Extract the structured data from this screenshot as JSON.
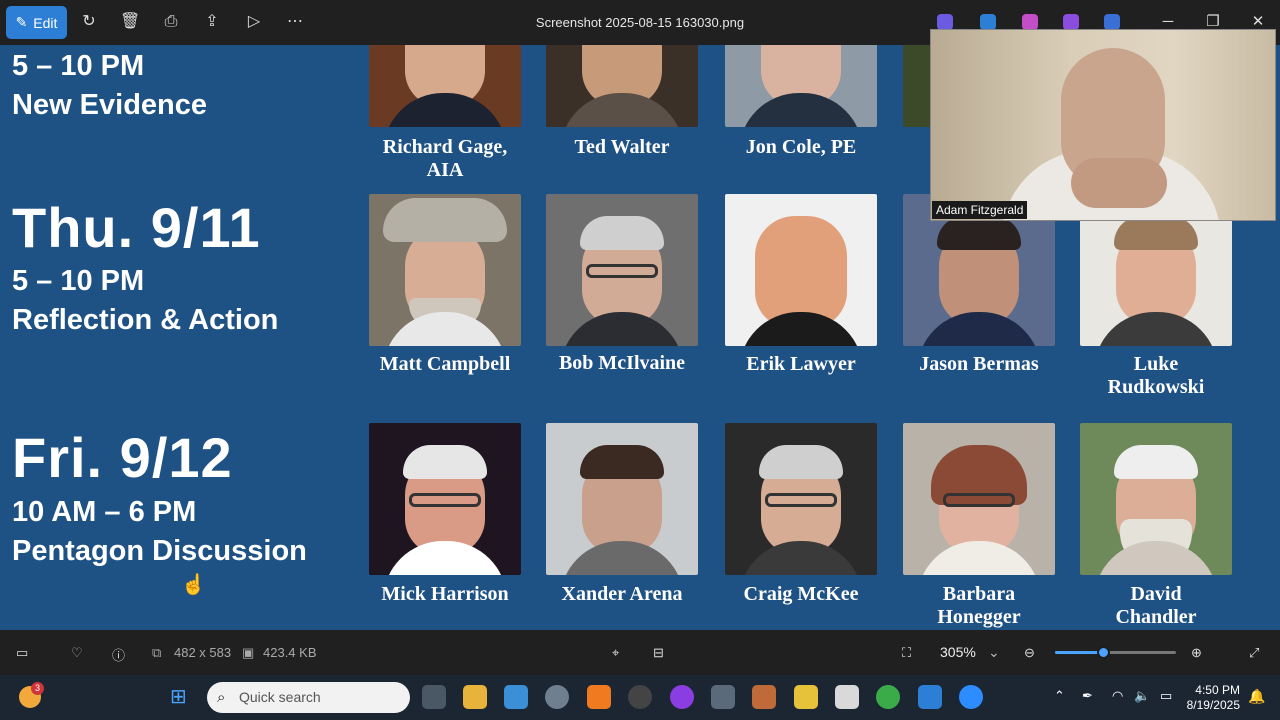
{
  "toolbar": {
    "edit_label": "Edit",
    "title": "Screenshot 2025-08-15 163030.png",
    "icons": [
      "rotate-icon",
      "delete-icon",
      "print-icon",
      "share-icon",
      "slideshow-icon",
      "more-icon"
    ]
  },
  "image": {
    "days": [
      {
        "date": "",
        "time": "5 – 10 PM",
        "topic": "New Evidence"
      },
      {
        "date": "Thu. 9/11",
        "time": "5 – 10 PM",
        "topic": "Reflection & Action"
      },
      {
        "date": "Fri. 9/12",
        "time": "10 AM – 6 PM",
        "topic": "Pentagon Discussion"
      }
    ],
    "speakers_row1": [
      "Richard Gage,\nAIA",
      "Ted Walter",
      "Jon Cole, PE"
    ],
    "speakers_row2": [
      "Matt Campbell",
      "Bob McIlvaine",
      "Erik Lawyer",
      "Jason Bermas",
      "Luke\nRudkowski"
    ],
    "speakers_row3": [
      "Mick Harrison",
      "Xander Arena",
      "Craig McKee",
      "Barbara\nHonegger",
      "David\nChandler"
    ]
  },
  "webcam": {
    "participant": "Adam Fitzgerald"
  },
  "statusbar": {
    "dimensions": "482 x 583",
    "file_size": "423.4 KB",
    "zoom": "305%",
    "zoom_fraction": 0.4
  },
  "taskbar": {
    "search_placeholder": "Quick search",
    "time": "4:50 PM",
    "date": "8/19/2025",
    "notification_count": "3"
  }
}
